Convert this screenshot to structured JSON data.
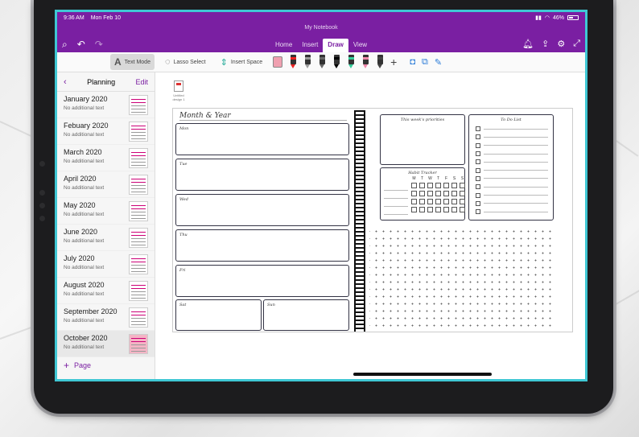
{
  "status_bar": {
    "time": "9:36 AM",
    "date": "Mon Feb 10",
    "battery": "46%"
  },
  "ribbon": {
    "notebook_title": "My Notebook",
    "tabs": [
      {
        "label": "Home",
        "active": false
      },
      {
        "label": "Insert",
        "active": false
      },
      {
        "label": "Draw",
        "active": true
      },
      {
        "label": "View",
        "active": false
      }
    ],
    "accent_color": "#7a1fa2"
  },
  "toolbar": {
    "text_mode": "Text Mode",
    "lasso_select": "Lasso Select",
    "insert_space": "Insert Space",
    "plus": "+"
  },
  "sidebar": {
    "section_title": "Planning",
    "edit_label": "Edit",
    "add_page_label": "Page",
    "pages": [
      {
        "name": "January 2020",
        "sub": "No additional text"
      },
      {
        "name": "Febuary 2020",
        "sub": "No additional text"
      },
      {
        "name": "March 2020",
        "sub": "No additional text"
      },
      {
        "name": "April 2020",
        "sub": "No additional text"
      },
      {
        "name": "May 2020",
        "sub": "No additional text"
      },
      {
        "name": "June 2020",
        "sub": "No additional text"
      },
      {
        "name": "July 2020",
        "sub": "No additional text"
      },
      {
        "name": "August 2020",
        "sub": "No additional text"
      },
      {
        "name": "September 2020",
        "sub": "No additional text"
      },
      {
        "name": "October 2020",
        "sub": "No additional text"
      }
    ]
  },
  "canvas": {
    "file_label": "Untitled design 1",
    "planner": {
      "month_title": "Month & Year",
      "days": [
        "Mon",
        "Tue",
        "Wed",
        "Thu",
        "Fri",
        "Sat",
        "Sun"
      ],
      "priorities_title": "This week's priorities",
      "todo_title": "To Do List",
      "habit_title": "Habit Tracker",
      "habit_days": [
        "M",
        "T",
        "W",
        "T",
        "F",
        "S",
        "S"
      ]
    }
  }
}
